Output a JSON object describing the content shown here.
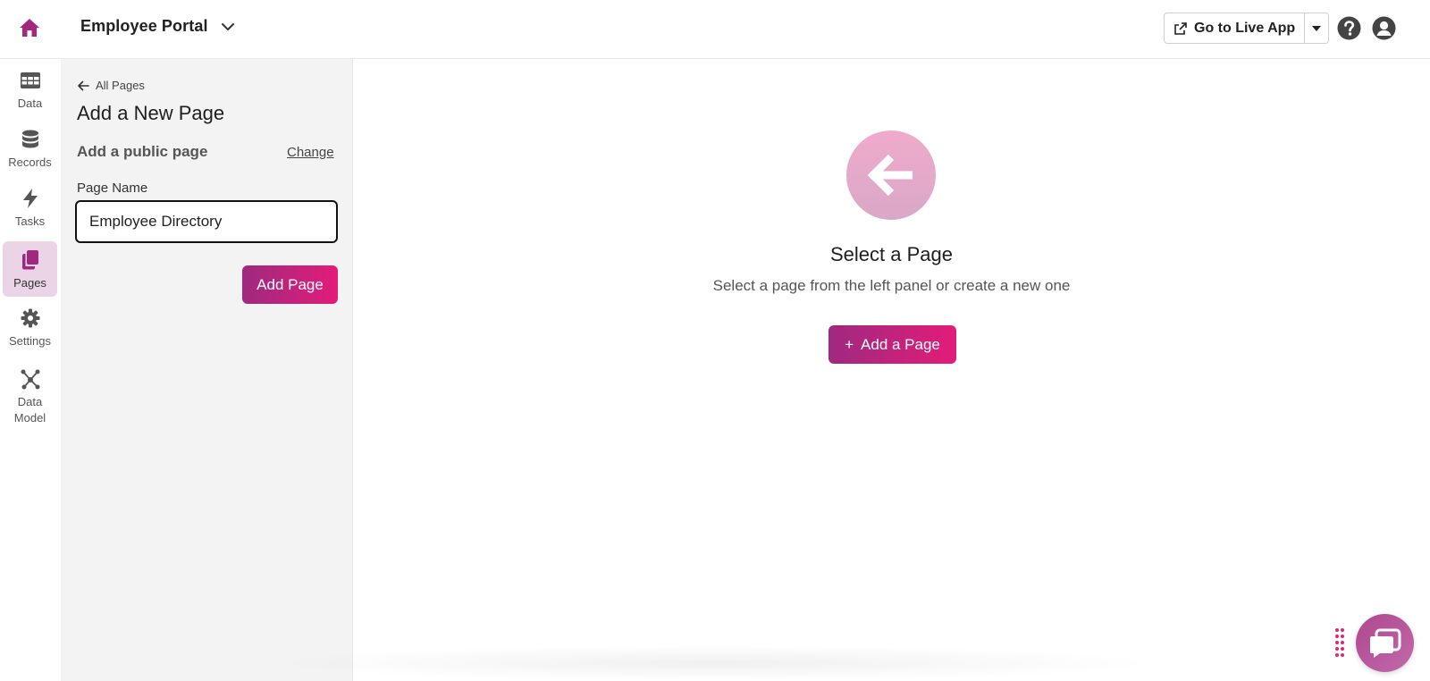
{
  "app": {
    "title": "Employee Portal"
  },
  "header": {
    "live_app_label": "Go to Live App"
  },
  "nav": {
    "items": [
      {
        "label": "Data",
        "icon": "table-icon"
      },
      {
        "label": "Records",
        "icon": "database-icon"
      },
      {
        "label": "Tasks",
        "icon": "lightning-icon"
      },
      {
        "label": "Pages",
        "icon": "pages-icon",
        "active": true
      },
      {
        "label": "Settings",
        "icon": "gear-icon"
      },
      {
        "label": "Data Model",
        "icon": "network-icon"
      }
    ]
  },
  "panel": {
    "back_label": "All Pages",
    "title": "Add a New Page",
    "public_label": "Add a public page",
    "change_label": "Change",
    "field_label": "Page Name",
    "field_value": "Employee Directory",
    "submit_label": "Add Page"
  },
  "main": {
    "empty_title": "Select a Page",
    "empty_subtitle": "Select a page from the left panel or create a new one",
    "add_button_label": "Add a Page",
    "add_button_icon": "+"
  },
  "colors": {
    "brand_start": "#9e2a7f",
    "brand_end": "#e31c79",
    "nav_active_bg": "#ecd4e7",
    "panel_bg": "#f3f3f3"
  }
}
